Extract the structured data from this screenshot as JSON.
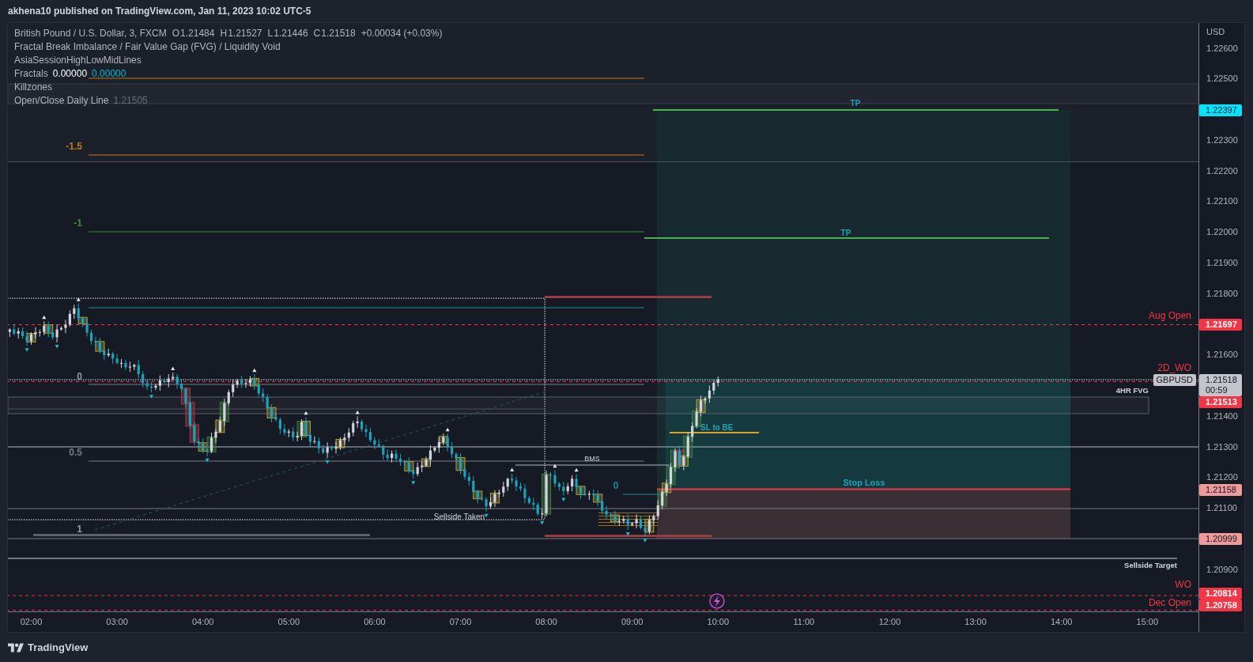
{
  "header": {
    "text": "akhena10 published on TradingView.com, Jan 11, 2023 10:02 UTC-5"
  },
  "legend": {
    "symbol": "British Pound / U.S. Dollar, 3, FXCM",
    "ohlc": [
      {
        "label": "O",
        "value": "1.21484"
      },
      {
        "label": "H",
        "value": "1.21527"
      },
      {
        "label": "L",
        "value": "1.21446"
      },
      {
        "label": "C",
        "value": "1.21518"
      }
    ],
    "change": "+0.00034 (+0.03%)",
    "indicators": [
      {
        "name": "Fractal Break Imbalance / Fair Value Gap (FVG) / Liquidity Void"
      },
      {
        "name": "AsiaSessionHighLowMidLines"
      },
      {
        "name": "Fractals",
        "values": [
          {
            "text": "0.00000",
            "color": "#ffffff"
          },
          {
            "text": "0.00000",
            "color": "#00bcd4"
          }
        ]
      },
      {
        "name": "Killzones"
      },
      {
        "name": "Open/Close Daily Line",
        "values": [
          {
            "text": "1.21505",
            "color": "#6a6d78"
          }
        ]
      }
    ]
  },
  "chart_labels": [
    {
      "text": "TP",
      "color": "#22a2b5"
    },
    {
      "text": "-1.5",
      "color": "#c27a14"
    },
    {
      "text": "-1",
      "color": "#388e3c"
    },
    {
      "text": "TP",
      "color": "#22a2b5"
    },
    {
      "text": "Aug Open",
      "color": "#f23645"
    },
    {
      "text": "2D_WO",
      "color": "#f23645"
    },
    {
      "text": "0",
      "color": "#9598a1"
    },
    {
      "text": "4HR FVG",
      "color": "#d1d4dc"
    },
    {
      "text": "SL to BE",
      "color": "#22a2b5"
    },
    {
      "text": "0.5",
      "color": "#787b86"
    },
    {
      "text": "BMS",
      "color": "#d1d4dc"
    },
    {
      "text": "0",
      "color": "#1e8a9c"
    },
    {
      "text": "Stop Loss",
      "color": "#22a2b5"
    },
    {
      "text": "Sellside Taken",
      "color": "#d1d4dc"
    },
    {
      "text": "1",
      "color": "#9598a1"
    },
    {
      "text": "Sellside Target",
      "color": "#d1d4dc"
    },
    {
      "text": "WO",
      "color": "#f23645"
    },
    {
      "text": "Dec Open",
      "color": "#f23645"
    }
  ],
  "price_axis": {
    "currency": "USD",
    "ticks": [
      "1.22600",
      "1.22500",
      "1.22300",
      "1.22200",
      "1.22100",
      "1.22000",
      "1.21900",
      "1.21800",
      "1.21600",
      "1.21400",
      "1.21300",
      "1.21200",
      "1.21100",
      "1.20900"
    ],
    "badges": [
      {
        "kind": "level",
        "price": "1.22397",
        "color": "#00e5ff"
      },
      {
        "kind": "level",
        "price": "1.21697",
        "color": "#f23645"
      },
      {
        "kind": "current",
        "symbol": "GBPUSD",
        "price": "1.21518",
        "countdown": "00:59",
        "color": "#c3c5cb"
      },
      {
        "kind": "level",
        "price": "1.21513",
        "color": "#f23645"
      },
      {
        "kind": "level",
        "price": "1.21158",
        "color": "#ef9a9a"
      },
      {
        "kind": "level",
        "price": "1.20999",
        "color": "#ef9a9a"
      },
      {
        "kind": "level",
        "price": "1.20814",
        "color": "#f23645"
      },
      {
        "kind": "level",
        "price": "1.20758",
        "color": "#f23645"
      }
    ]
  },
  "time_axis": {
    "ticks": [
      "02:00",
      "03:00",
      "04:00",
      "05:00",
      "06:00",
      "07:00",
      "08:00",
      "09:00",
      "10:00",
      "11:00",
      "12:00",
      "13:00",
      "14:00",
      "15:00"
    ]
  },
  "footer": {
    "logo": "TradingView"
  }
}
